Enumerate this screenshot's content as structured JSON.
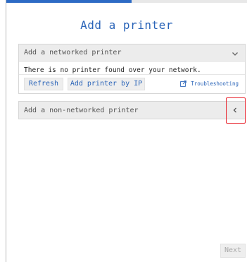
{
  "wizard": {
    "title": "Add a printer",
    "progress_fraction": 0.52
  },
  "networked": {
    "header": "Add a networked printer",
    "expanded": true,
    "chevron_icon": "chevron-down-icon",
    "message": "There is no printer found over your network.",
    "refresh_label": "Refresh",
    "add_by_ip_label": "Add printer by IP",
    "troubleshooting_label": "Troubleshooting",
    "troubleshooting_icon": "external-link-icon"
  },
  "non_networked": {
    "header": "Add a non-networked printer",
    "expanded": false,
    "chevron_icon": "chevron-left-icon"
  },
  "footer": {
    "next_label": "Next",
    "next_enabled": false
  },
  "colors": {
    "accent": "#2a64b8",
    "progress": "#2d6bc5",
    "highlight": "#e8202a",
    "panel_header": "#ececec"
  }
}
